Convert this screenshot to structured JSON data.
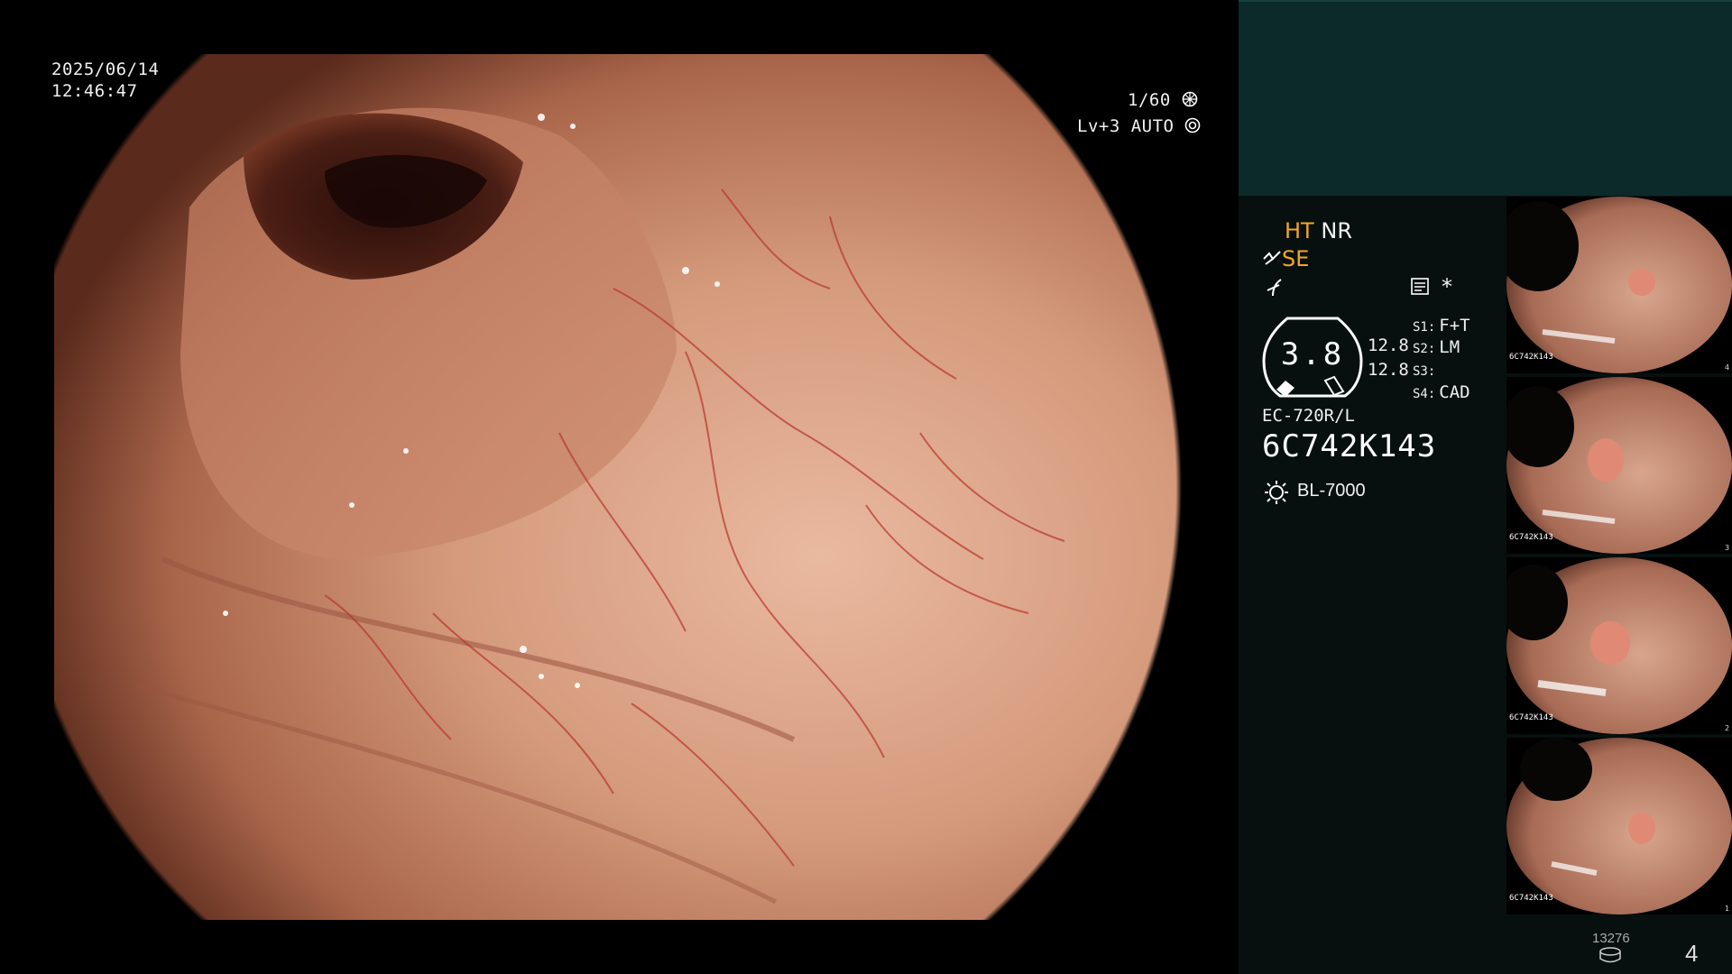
{
  "colors": {
    "accent_orange": "#f5a623",
    "panel_dark": "#07100f",
    "panel_teal": "#0c2a2a",
    "tissue": "#c88a6b",
    "vessel": "#b8362a"
  },
  "capture": {
    "date": "2025/06/14",
    "time": "12:46:47"
  },
  "exposure": {
    "shutter": "1/60",
    "shutter_icon": "shutter-icon",
    "level": "Lv+3",
    "mode": "AUTO",
    "mode_icon": "auto-exposure-icon"
  },
  "processing": {
    "ht": "HT",
    "nr": "NR",
    "se_icon": "structure-enhance-icon",
    "se": "SE",
    "color_icon": "color-mode-icon",
    "memo_icon": "memo-icon",
    "star": "*"
  },
  "gauge": {
    "value": "3.8",
    "value_a": "12.8",
    "value_b": "12.8"
  },
  "switches": [
    {
      "key": "S1:",
      "value": "F+T"
    },
    {
      "key": "S2:",
      "value": "LM"
    },
    {
      "key": "S3:",
      "value": ""
    },
    {
      "key": "S4:",
      "value": "CAD"
    }
  ],
  "scope": {
    "model": "EC-720R/L",
    "serial": "6C742K143"
  },
  "light": {
    "icon": "light-source-icon",
    "name": "BL-7000"
  },
  "thumbnails": [
    {
      "serial": "6C742K143",
      "index": "4"
    },
    {
      "serial": "6C742K143",
      "index": "3"
    },
    {
      "serial": "6C742K143",
      "index": "2"
    },
    {
      "serial": "6C742K143",
      "index": "1"
    }
  ],
  "footer": {
    "storage_count": "13276",
    "storage_icon": "storage-icon",
    "page": "4"
  }
}
